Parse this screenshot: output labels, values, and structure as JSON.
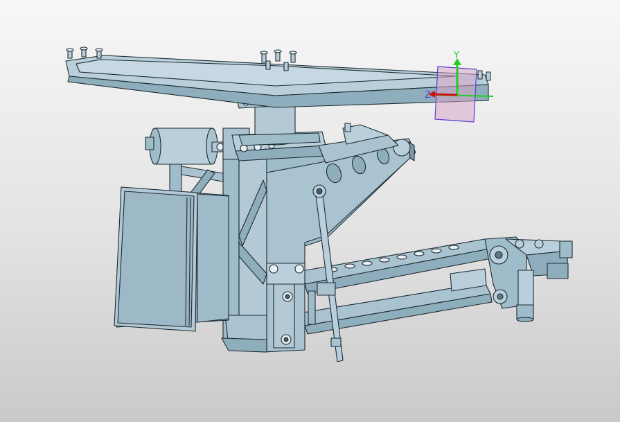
{
  "viewport": {
    "background_top": "#f7f7f7",
    "background_bottom": "#c9c9c9"
  },
  "model": {
    "part_color": "#9fbccb",
    "part_color_light": "#b9d0dc",
    "part_color_dark": "#7e9cac",
    "edge_color": "#1d2a31"
  },
  "triad": {
    "y_label": "Y",
    "z_label": "Z",
    "x_color": "#22cc22",
    "y_color": "#22cc22",
    "z_color": "#cc1111",
    "plane_color": "#d8a6c8",
    "plane_border": "#5a3fd0"
  }
}
